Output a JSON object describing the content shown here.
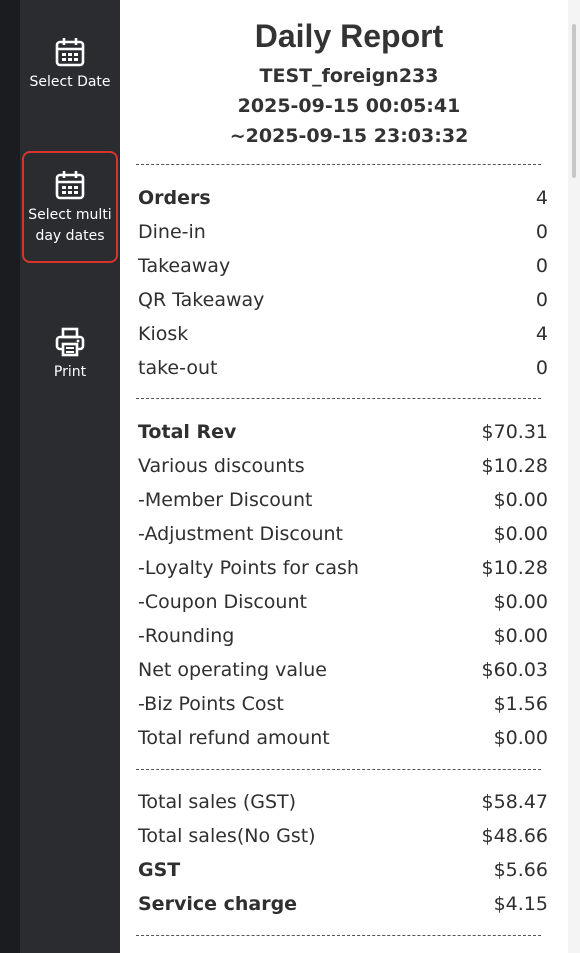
{
  "sidebar": {
    "items": [
      {
        "label": "Select Date"
      },
      {
        "label": "Select multi day dates"
      },
      {
        "label": "Print"
      }
    ]
  },
  "report": {
    "title": "Daily Report",
    "store": "TEST_foreign233",
    "start": "2025-09-15 00:05:41",
    "end": "~2025-09-15 23:03:32",
    "orders": [
      {
        "label": "Orders",
        "value": "4"
      },
      {
        "label": "Dine-in",
        "value": "0"
      },
      {
        "label": "Takeaway",
        "value": "0"
      },
      {
        "label": "QR Takeaway",
        "value": "0"
      },
      {
        "label": "Kiosk",
        "value": "4"
      },
      {
        "label": "take-out",
        "value": "0"
      }
    ],
    "revenue": [
      {
        "label": "Total Rev",
        "value": "$70.31"
      },
      {
        "label": "Various discounts",
        "value": "$10.28"
      },
      {
        "label": "-Member Discount",
        "value": "$0.00"
      },
      {
        "label": "-Adjustment Discount",
        "value": "$0.00"
      },
      {
        "label": "-Loyalty Points for cash",
        "value": "$10.28"
      },
      {
        "label": "-Coupon Discount",
        "value": "$0.00"
      },
      {
        "label": "-Rounding",
        "value": "$0.00"
      },
      {
        "label": "Net operating value",
        "value": "$60.03"
      },
      {
        "label": "-Biz Points Cost",
        "value": "$1.56"
      },
      {
        "label": "Total refund amount",
        "value": "$0.00"
      }
    ],
    "sales": [
      {
        "label": "Total sales (GST)",
        "value": "$58.47"
      },
      {
        "label": "Total sales(No Gst)",
        "value": "$48.66"
      },
      {
        "label": "GST",
        "value": "$5.66"
      },
      {
        "label": "Service charge",
        "value": "$4.15"
      }
    ]
  },
  "icons": {
    "select_date": "calendar-icon",
    "multi_date": "calendar-icon",
    "print": "printer-icon"
  },
  "colors": {
    "sidebar_bg": "#2b2c30",
    "active_border": "#d9342b",
    "text": "#2f2f2f"
  }
}
